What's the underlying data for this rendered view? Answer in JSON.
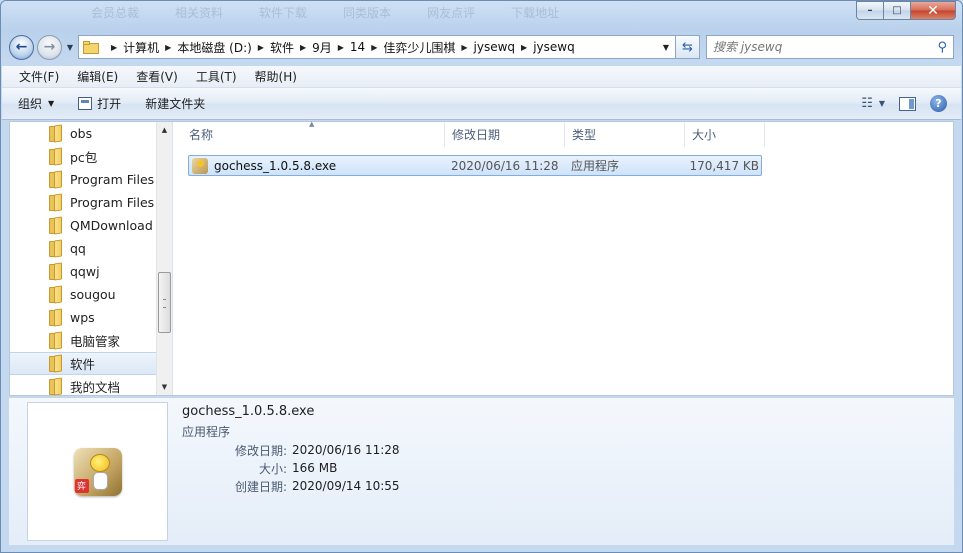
{
  "title_ghost_text": [
    "会员总裁",
    "相关资料",
    "软件下载",
    "同类版本",
    "网友点评",
    "下载地址"
  ],
  "caption": {
    "minimize": "▭",
    "maximize": "□",
    "close": "✕"
  },
  "address": {
    "crumbs": [
      "计算机",
      "本地磁盘 (D:)",
      "软件",
      "9月",
      "14",
      "佳弈少儿围棋",
      "jysewq",
      "jysewq"
    ]
  },
  "search": {
    "placeholder": "搜索 jysewq"
  },
  "menu": [
    "文件(F)",
    "编辑(E)",
    "查看(V)",
    "工具(T)",
    "帮助(H)"
  ],
  "commands": {
    "organize": "组织",
    "open": "打开",
    "new_folder": "新建文件夹"
  },
  "nav_items": [
    {
      "label": "obs",
      "selected": false
    },
    {
      "label": "pc包",
      "selected": false
    },
    {
      "label": "Program Files",
      "selected": false
    },
    {
      "label": "Program Files",
      "selected": false
    },
    {
      "label": "QMDownload",
      "selected": false
    },
    {
      "label": "qq",
      "selected": false
    },
    {
      "label": "qqwj",
      "selected": false
    },
    {
      "label": "sougou",
      "selected": false
    },
    {
      "label": "wps",
      "selected": false
    },
    {
      "label": "电脑管家",
      "selected": false
    },
    {
      "label": "软件",
      "selected": true
    },
    {
      "label": "我的文档",
      "selected": false
    }
  ],
  "columns": {
    "name": "名称",
    "date": "修改日期",
    "type": "类型",
    "size": "大小"
  },
  "files": [
    {
      "name": "gochess_1.0.5.8.exe",
      "date": "2020/06/16 11:28",
      "type": "应用程序",
      "size": "170,417 KB"
    }
  ],
  "details": {
    "title": "gochess_1.0.5.8.exe",
    "type": "应用程序",
    "badge_text": "弈",
    "props": [
      {
        "k": "修改日期:",
        "v": "2020/06/16 11:28"
      },
      {
        "k": "大小:",
        "v": "166 MB"
      },
      {
        "k": "创建日期:",
        "v": "2020/09/14 10:55"
      }
    ]
  }
}
